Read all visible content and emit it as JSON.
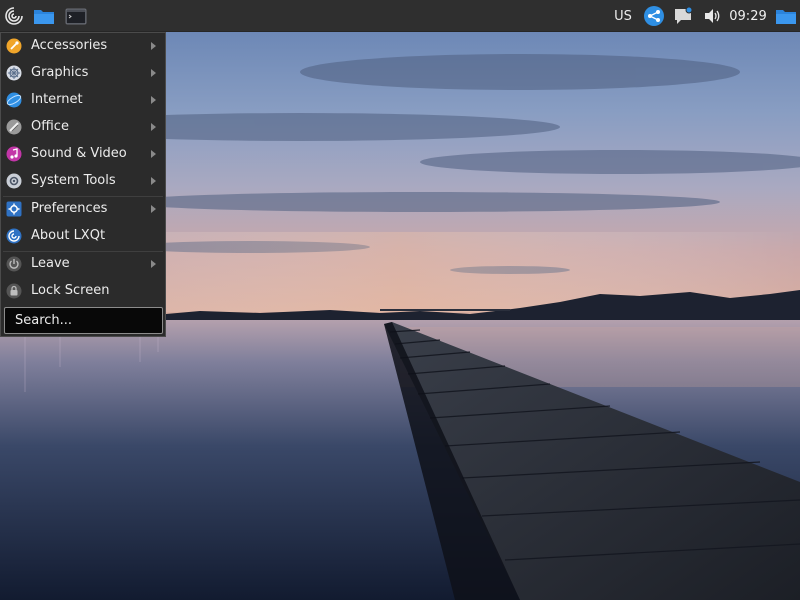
{
  "panel": {
    "keyboard_layout": "US",
    "clock": "09:29"
  },
  "menu": {
    "items": [
      {
        "label": "Accessories",
        "icon": "accessories-icon"
      },
      {
        "label": "Graphics",
        "icon": "graphics-icon"
      },
      {
        "label": "Internet",
        "icon": "internet-icon"
      },
      {
        "label": "Office",
        "icon": "office-icon"
      },
      {
        "label": "Sound & Video",
        "icon": "sound-video-icon"
      },
      {
        "label": "System Tools",
        "icon": "system-tools-icon"
      },
      {
        "label": "Preferences",
        "icon": "preferences-icon"
      },
      {
        "label": "About LXQt",
        "icon": "about-lxqt-icon"
      },
      {
        "label": "Leave",
        "icon": "leave-icon"
      },
      {
        "label": "Lock Screen",
        "icon": "lock-screen-icon"
      }
    ],
    "search_placeholder": "Search..."
  },
  "colors": {
    "panel_bg": "#2f2f2f",
    "menu_bg": "#2b2b2b",
    "accent_blue": "#2f8fe3"
  }
}
